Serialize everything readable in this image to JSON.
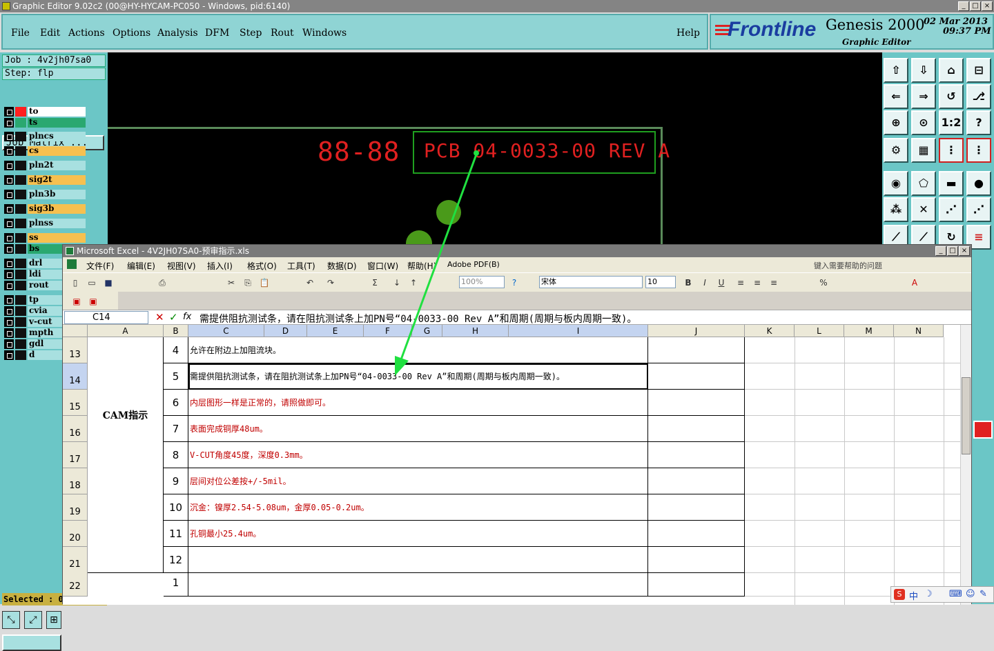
{
  "window": {
    "title": "Graphic Editor 9.02c2 (00@HY-HYCAM-PC050 - Windows, pid:6140)"
  },
  "menu": {
    "items": [
      "File",
      "Edit",
      "Actions",
      "Options",
      "Analysis",
      "DFM",
      "Step",
      "Rout",
      "Windows"
    ],
    "help": "Help"
  },
  "brand": {
    "logo": "Frontline",
    "product": "Genesis 2000",
    "subtitle": "Graphic Editor",
    "date": "02 Mar 2013",
    "time": "09:37 PM"
  },
  "job": {
    "job_label": "Job : 4v2jh07sa0",
    "step_label": "Step: flp",
    "matrix_button": "Job Matrix ..."
  },
  "layers": [
    {
      "name": "to",
      "color": "#ffffff",
      "swatch": "#ff2020"
    },
    {
      "name": "ts",
      "color": "#2aa870",
      "swatch": "#2aa870"
    },
    {
      "name": "plncs",
      "color": "#a8e0e0",
      "swatch": "#111111"
    },
    {
      "name": "cs",
      "color": "#f6c050",
      "swatch": "#111111"
    },
    {
      "name": "pln2t",
      "color": "#a8e0e0",
      "swatch": "#111111"
    },
    {
      "name": "sig2t",
      "color": "#f6c050",
      "swatch": "#111111"
    },
    {
      "name": "pln3b",
      "color": "#a8e0e0",
      "swatch": "#111111"
    },
    {
      "name": "sig3b",
      "color": "#f6c050",
      "swatch": "#111111"
    },
    {
      "name": "plnss",
      "color": "#a8e0e0",
      "swatch": "#111111"
    },
    {
      "name": "ss",
      "color": "#f6c050",
      "swatch": "#111111"
    },
    {
      "name": "bs",
      "color": "#2aa870",
      "swatch": "#111111"
    },
    {
      "name": "drl",
      "color": "#a8e0e0",
      "swatch": "#111111"
    },
    {
      "name": "ldi",
      "color": "#a8e0e0",
      "swatch": "#111111"
    },
    {
      "name": "rout",
      "color": "#a8e0e0",
      "swatch": "#111111"
    },
    {
      "name": "tp",
      "color": "#a8e0e0",
      "swatch": "#111111"
    },
    {
      "name": "cvia",
      "color": "#a8e0e0",
      "swatch": "#111111"
    },
    {
      "name": "v-cut",
      "color": "#a8e0e0",
      "swatch": "#111111"
    },
    {
      "name": "mpth",
      "color": "#a8e0e0",
      "swatch": "#111111"
    },
    {
      "name": "gdl",
      "color": "#a8e0e0",
      "swatch": "#111111"
    },
    {
      "name": "d",
      "color": "#a8e0e0",
      "swatch": "#111111"
    }
  ],
  "status": {
    "selected": "Selected : 0"
  },
  "canvas": {
    "pcb_text": "PCB 04-0033-00 REV A",
    "date_code": "88-88"
  },
  "excel": {
    "title": "Microsoft Excel - 4V2JH07SA0-预审指示.xls",
    "menu": [
      "文件(F)",
      "编辑(E)",
      "视图(V)",
      "插入(I)",
      "格式(O)",
      "工具(T)",
      "数据(D)",
      "窗口(W)",
      "帮助(H)",
      "Adobe PDF(B)"
    ],
    "help_placeholder": "键入需要帮助的问题",
    "font": "宋体",
    "font_size": "10",
    "zoom": "100%",
    "name_box": "C14",
    "formula": "需提供阻抗测试条，请在阻抗测试条上加PN号“04-0033-00 Rev A”和周期(周期与板内周期一致)。",
    "columns": [
      "A",
      "B",
      "C",
      "D",
      "E",
      "F",
      "G",
      "H",
      "I",
      "J",
      "K",
      "L",
      "M",
      "N"
    ],
    "section_label": "CAM指示",
    "rows": [
      {
        "row": "13",
        "num": "4",
        "text": "允许在附边上加阻流块。",
        "color": "#000000"
      },
      {
        "row": "14",
        "num": "5",
        "text": "需提供阻抗测试条，请在阻抗测试条上加PN号“04-0033-00 Rev A”和周期(周期与板内周期一致)。",
        "color": "#000000"
      },
      {
        "row": "15",
        "num": "6",
        "text": "内层图形一样是正常的，请照做即可。",
        "color": "#c00000"
      },
      {
        "row": "16",
        "num": "7",
        "text": "表面完成铜厚48um。",
        "color": "#c00000"
      },
      {
        "row": "17",
        "num": "8",
        "text": "V-CUT角度45度，深度0.3mm。",
        "color": "#c00000"
      },
      {
        "row": "18",
        "num": "9",
        "text": "层间对位公差按+/-5mil。",
        "color": "#c00000"
      },
      {
        "row": "19",
        "num": "10",
        "text": "沉金：镍厚2.54-5.08um，金厚0.05-0.2um。",
        "color": "#c00000"
      },
      {
        "row": "20",
        "num": "11",
        "text": "孔铜最小25.4um。",
        "color": "#c00000"
      },
      {
        "row": "21",
        "num": "12",
        "text": "",
        "color": "#000000"
      },
      {
        "row": "22",
        "num": "1",
        "text": "",
        "color": "#000000"
      }
    ]
  },
  "tray": {
    "ime": "中"
  }
}
